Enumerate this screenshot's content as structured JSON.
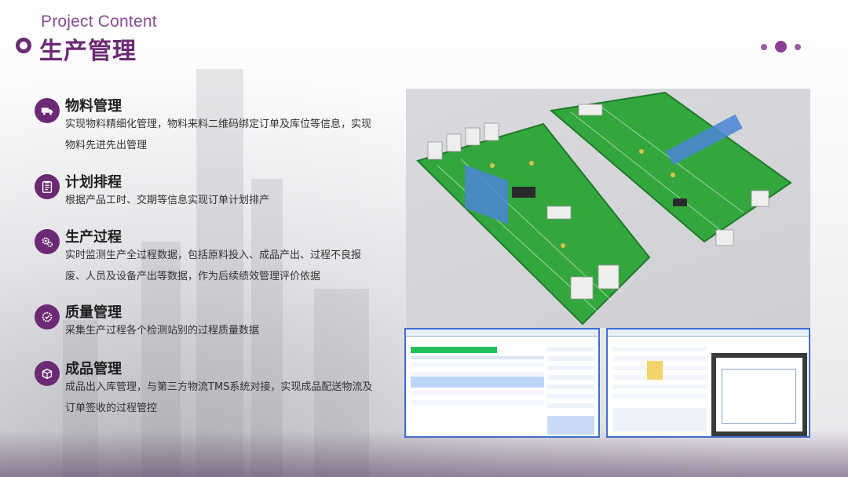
{
  "header": {
    "subtitle": "Project Content",
    "title": "生产管理"
  },
  "sections": [
    {
      "title": "物料管理",
      "icon": "truck-icon",
      "desc": "实现物料精细化管理，物料来料二维码绑定订单及库位等信息，实现物料先进先出管理"
    },
    {
      "title": "计划排程",
      "icon": "clipboard-list-icon",
      "desc": "根据产品工时、交期等信息实现订单计划排产"
    },
    {
      "title": "生产过程",
      "icon": "gears-icon",
      "desc": "实时监测生产全过程数据，包括原料投入、成品产出、过程不良报废、人员及设备产出等数据，作为后续绩效管理评价依据"
    },
    {
      "title": "质量管理",
      "icon": "quality-badge-icon",
      "desc": "采集生产过程各个检测站别的过程质量数据"
    },
    {
      "title": "成品管理",
      "icon": "package-icon",
      "desc": "成品出入库管理，与第三方物流TMS系统对接，实现成品配送物流及订单签收的过程管控"
    }
  ],
  "colors": {
    "brand": "#6b2a73",
    "accent": "#8b3f93",
    "screen_border": "#3d6fd0",
    "factory_floor": "#33a63d"
  }
}
